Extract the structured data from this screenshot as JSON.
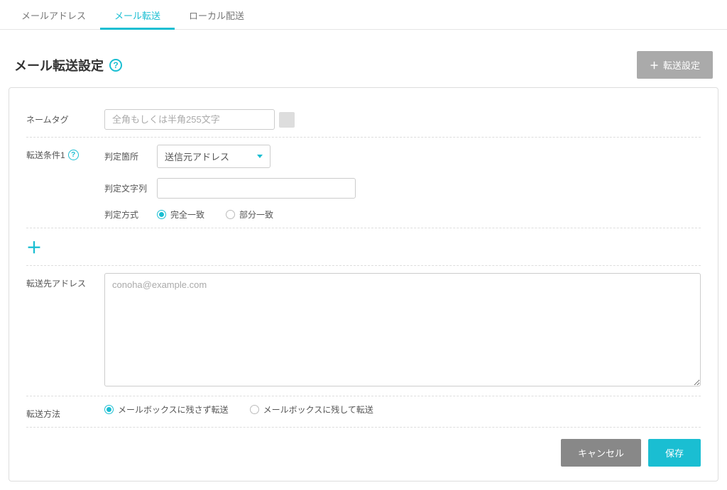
{
  "tabs": {
    "mail_address": "メールアドレス",
    "mail_forward": "メール転送",
    "local_delivery": "ローカル配送"
  },
  "header": {
    "title": "メール転送設定",
    "add_button": "転送設定"
  },
  "form": {
    "name_tag": {
      "label": "ネームタグ",
      "placeholder": "全角もしくは半角255文字"
    },
    "condition": {
      "label": "転送条件1",
      "judge_place_label": "判定箇所",
      "judge_place_value": "送信元アドレス",
      "judge_string_label": "判定文字列",
      "judge_string_value": "",
      "judge_method_label": "判定方式",
      "method_exact": "完全一致",
      "method_partial": "部分一致"
    },
    "forward_address": {
      "label": "転送先アドレス",
      "placeholder": "conoha@example.com"
    },
    "forward_method": {
      "label": "転送方法",
      "option_no_keep": "メールボックスに残さず転送",
      "option_keep": "メールボックスに残して転送"
    },
    "buttons": {
      "cancel": "キャンセル",
      "save": "保存"
    }
  }
}
